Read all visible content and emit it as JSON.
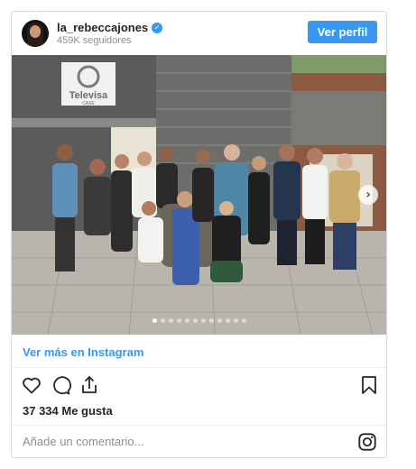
{
  "post": {
    "username": "la_rebeccajones",
    "verified_badge": "✓",
    "followers": "459K seguidores",
    "profile_button": "Ver perfil",
    "see_more": "Ver más en Instagram",
    "likes": "37 334 Me gusta",
    "comment_placeholder": "Añade un comentario...",
    "carousel": {
      "total": 12,
      "current": 1
    },
    "photo_signs": {
      "brand": "Televisa",
      "sub": "CASE"
    }
  },
  "icons": {
    "avatar": "avatar-image",
    "verified": "verified-badge-icon",
    "next": "chevron-right-icon",
    "like": "heart-icon",
    "comment": "comment-icon",
    "share": "share-icon",
    "save": "bookmark-icon",
    "instagram": "instagram-icon"
  },
  "colors": {
    "accent": "#3897f0",
    "text": "#262626",
    "muted": "#8e8e8e",
    "border": "#dbdbdb"
  }
}
